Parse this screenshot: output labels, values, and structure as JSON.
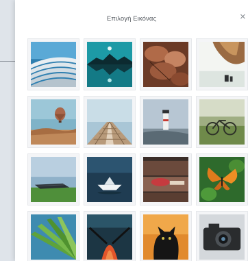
{
  "dialog": {
    "title": "Επιλογή Εικόνας",
    "close_icon": "close-icon"
  },
  "images": [
    {
      "name": "architecture-waves-image"
    },
    {
      "name": "lake-mountain-reflection-image"
    },
    {
      "name": "autumn-leaves-image"
    },
    {
      "name": "hot-air-balloon-sky-image"
    },
    {
      "name": "hot-air-balloon-desert-image"
    },
    {
      "name": "wooden-pier-image"
    },
    {
      "name": "lighthouse-image"
    },
    {
      "name": "bicycle-field-image"
    },
    {
      "name": "boat-on-shore-image"
    },
    {
      "name": "paper-boat-water-image"
    },
    {
      "name": "suitcase-vintage-image"
    },
    {
      "name": "butterfly-flower-image"
    },
    {
      "name": "palm-leaf-image"
    },
    {
      "name": "kayak-sea-image"
    },
    {
      "name": "black-cat-image"
    },
    {
      "name": "camera-image"
    }
  ]
}
